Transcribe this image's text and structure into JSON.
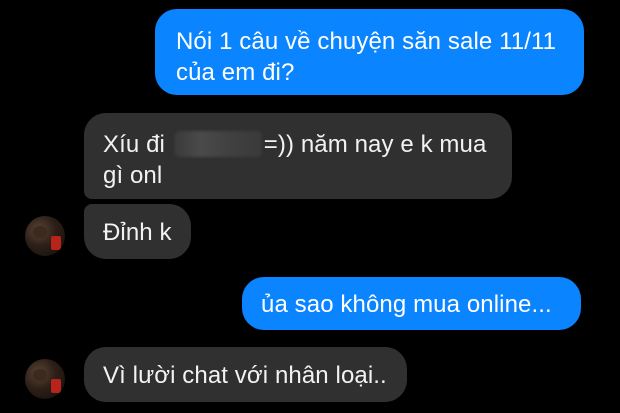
{
  "messages": [
    {
      "sender": "me",
      "text": "Nói 1 câu về chuyện săn sale 11/11 của em đi?"
    },
    {
      "sender": "them",
      "text_before": "Xíu đi",
      "text_after": "=)) năm nay e k mua gì onl",
      "redacted": true
    },
    {
      "sender": "them",
      "text": "Đỉnh k"
    },
    {
      "sender": "me",
      "text": "ủa sao không mua online..."
    },
    {
      "sender": "them",
      "text": "Vì lười chat với nhân loại.."
    }
  ],
  "colors": {
    "background": "#000000",
    "outgoing_bubble": "#0a84ff",
    "incoming_bubble": "#303030",
    "text": "#ffffff"
  }
}
